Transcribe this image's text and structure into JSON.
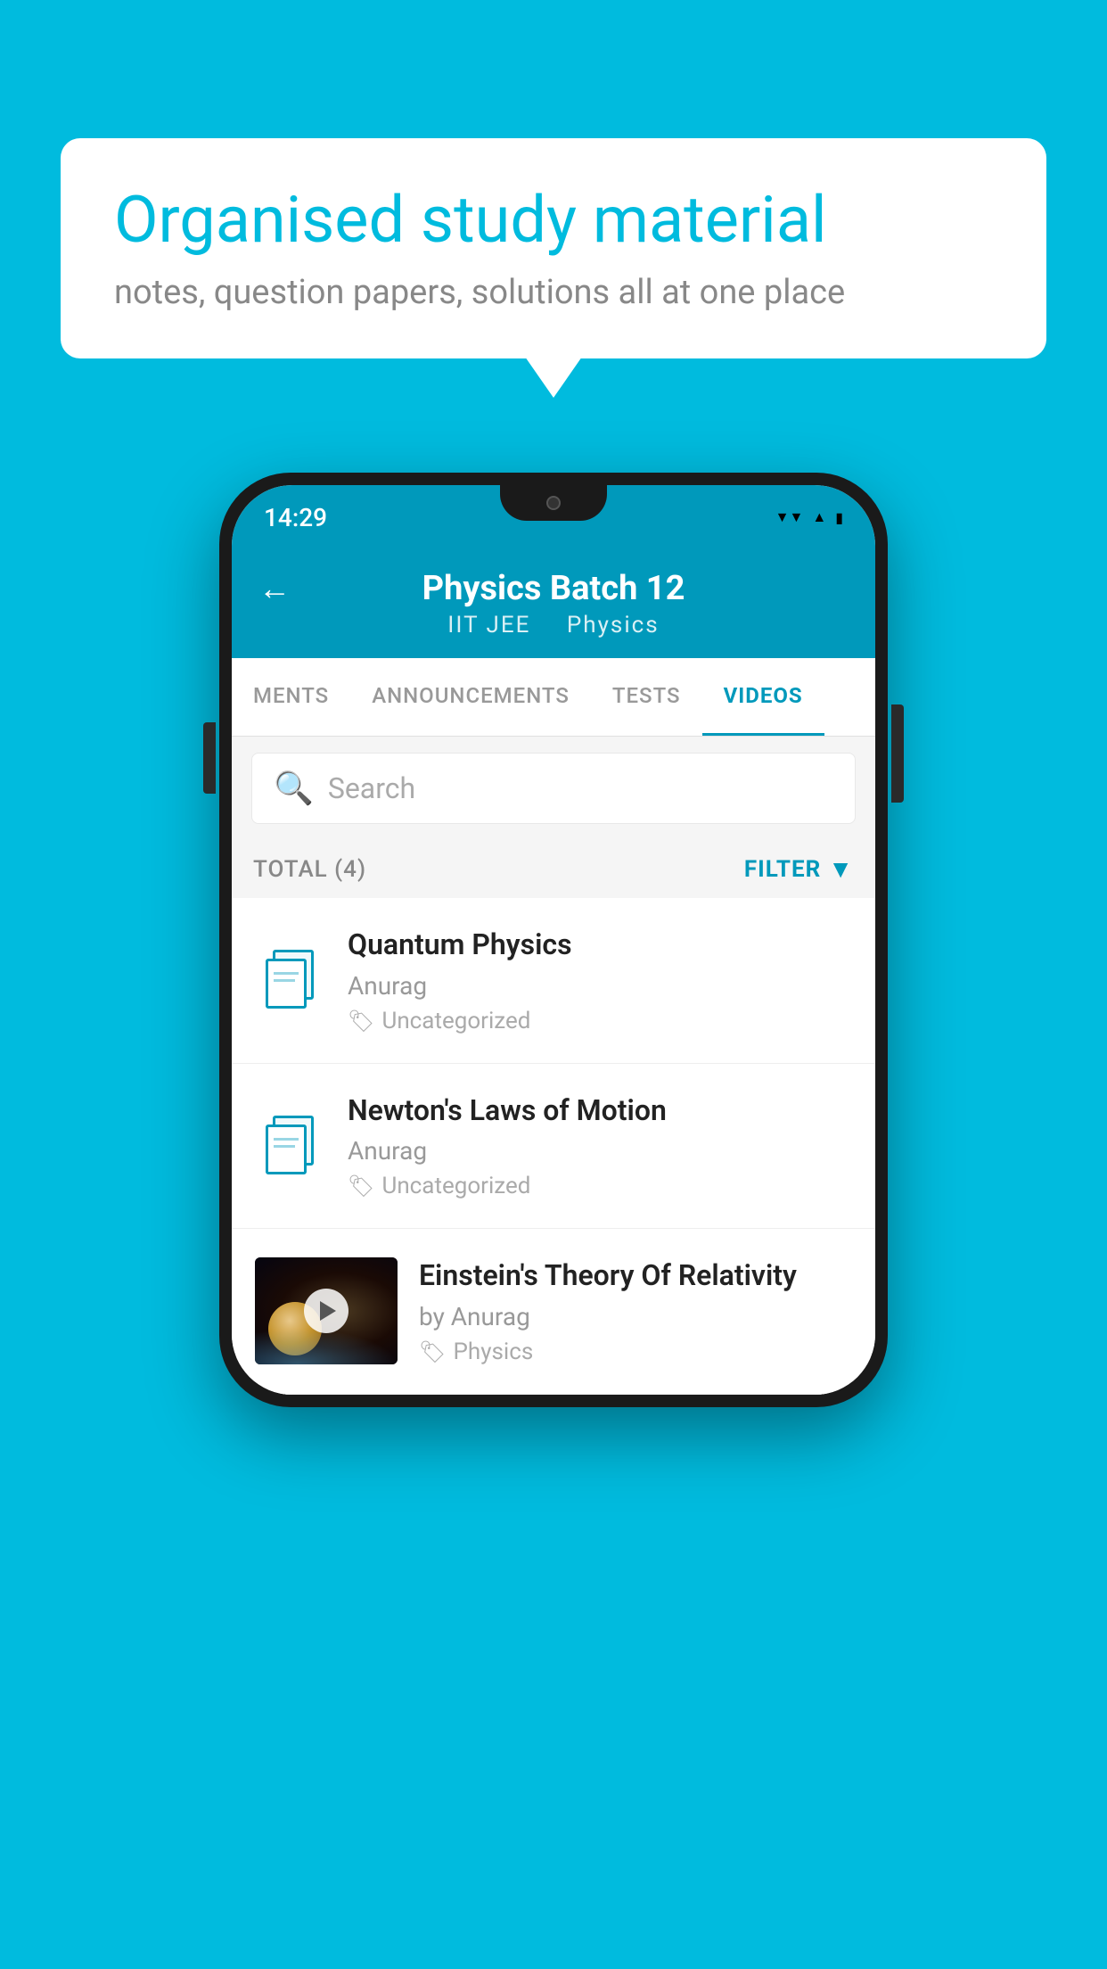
{
  "background": {
    "color": "#00BBDE"
  },
  "speech_bubble": {
    "title": "Organised study material",
    "subtitle": "notes, question papers, solutions all at one place"
  },
  "status_bar": {
    "time": "14:29",
    "wifi_icon": "wifi",
    "signal_icon": "signal",
    "battery_icon": "battery"
  },
  "app_header": {
    "back_label": "←",
    "title": "Physics Batch 12",
    "subtitle_part1": "IIT JEE",
    "subtitle_part2": "Physics"
  },
  "tabs": [
    {
      "label": "MENTS",
      "active": false
    },
    {
      "label": "ANNOUNCEMENTS",
      "active": false
    },
    {
      "label": "TESTS",
      "active": false
    },
    {
      "label": "VIDEOS",
      "active": true
    }
  ],
  "search": {
    "placeholder": "Search"
  },
  "filter_row": {
    "total_label": "TOTAL (4)",
    "filter_label": "FILTER"
  },
  "videos": [
    {
      "id": 1,
      "title": "Quantum Physics",
      "author": "Anurag",
      "tag": "Uncategorized",
      "has_thumbnail": false
    },
    {
      "id": 2,
      "title": "Newton's Laws of Motion",
      "author": "Anurag",
      "tag": "Uncategorized",
      "has_thumbnail": false
    },
    {
      "id": 3,
      "title": "Einstein's Theory Of Relativity",
      "author": "by Anurag",
      "tag": "Physics",
      "has_thumbnail": true
    }
  ]
}
